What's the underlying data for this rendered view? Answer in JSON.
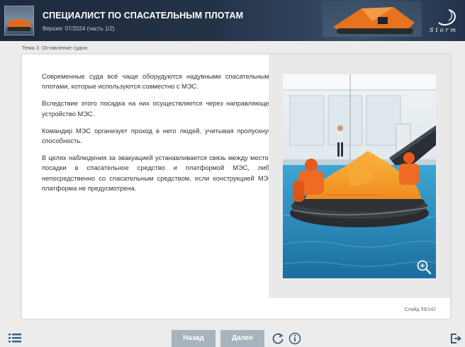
{
  "header": {
    "title": "СПЕЦИАЛИСТ ПО СПАСАТЕЛЬНЫМ ПЛОТАМ",
    "version": "Версия: 07/2024 (часть 1/2)",
    "logo_text": "Storm"
  },
  "breadcrumb": "Тема 3. Оставление судна",
  "content": {
    "paragraphs": [
      "Современные суда всё чаще оборудуются надувными спасательными плотами, которые используются совместно с МЭС.",
      "Вследствие этого посадка на них осуществляется через направляющее устройство МЭС.",
      "Командир МЭС организует проход в него людей, учитывая пропускную способность.",
      "В целях наблюдения за эвакуацией устанавливается связь между местом посадки в спасательное средство и платформой МЭС, либо непосредственно со спасательным средством, если конструкцией МЭС платформа не предусмотрена."
    ],
    "slide_counter": "Слайд 59/142"
  },
  "footer": {
    "back_label": "Назад",
    "next_label": "Далее"
  },
  "icons": {
    "menu": "list-icon",
    "reload": "reload-icon",
    "info": "info-icon",
    "exit": "exit-icon",
    "zoom": "zoom-in-icon"
  },
  "colors": {
    "header_bg": "#243247",
    "button_bg": "#a7b3be",
    "raft_orange": "#f39a2a",
    "water": "#2f93c4",
    "footer_icon": "#3a5b78"
  }
}
